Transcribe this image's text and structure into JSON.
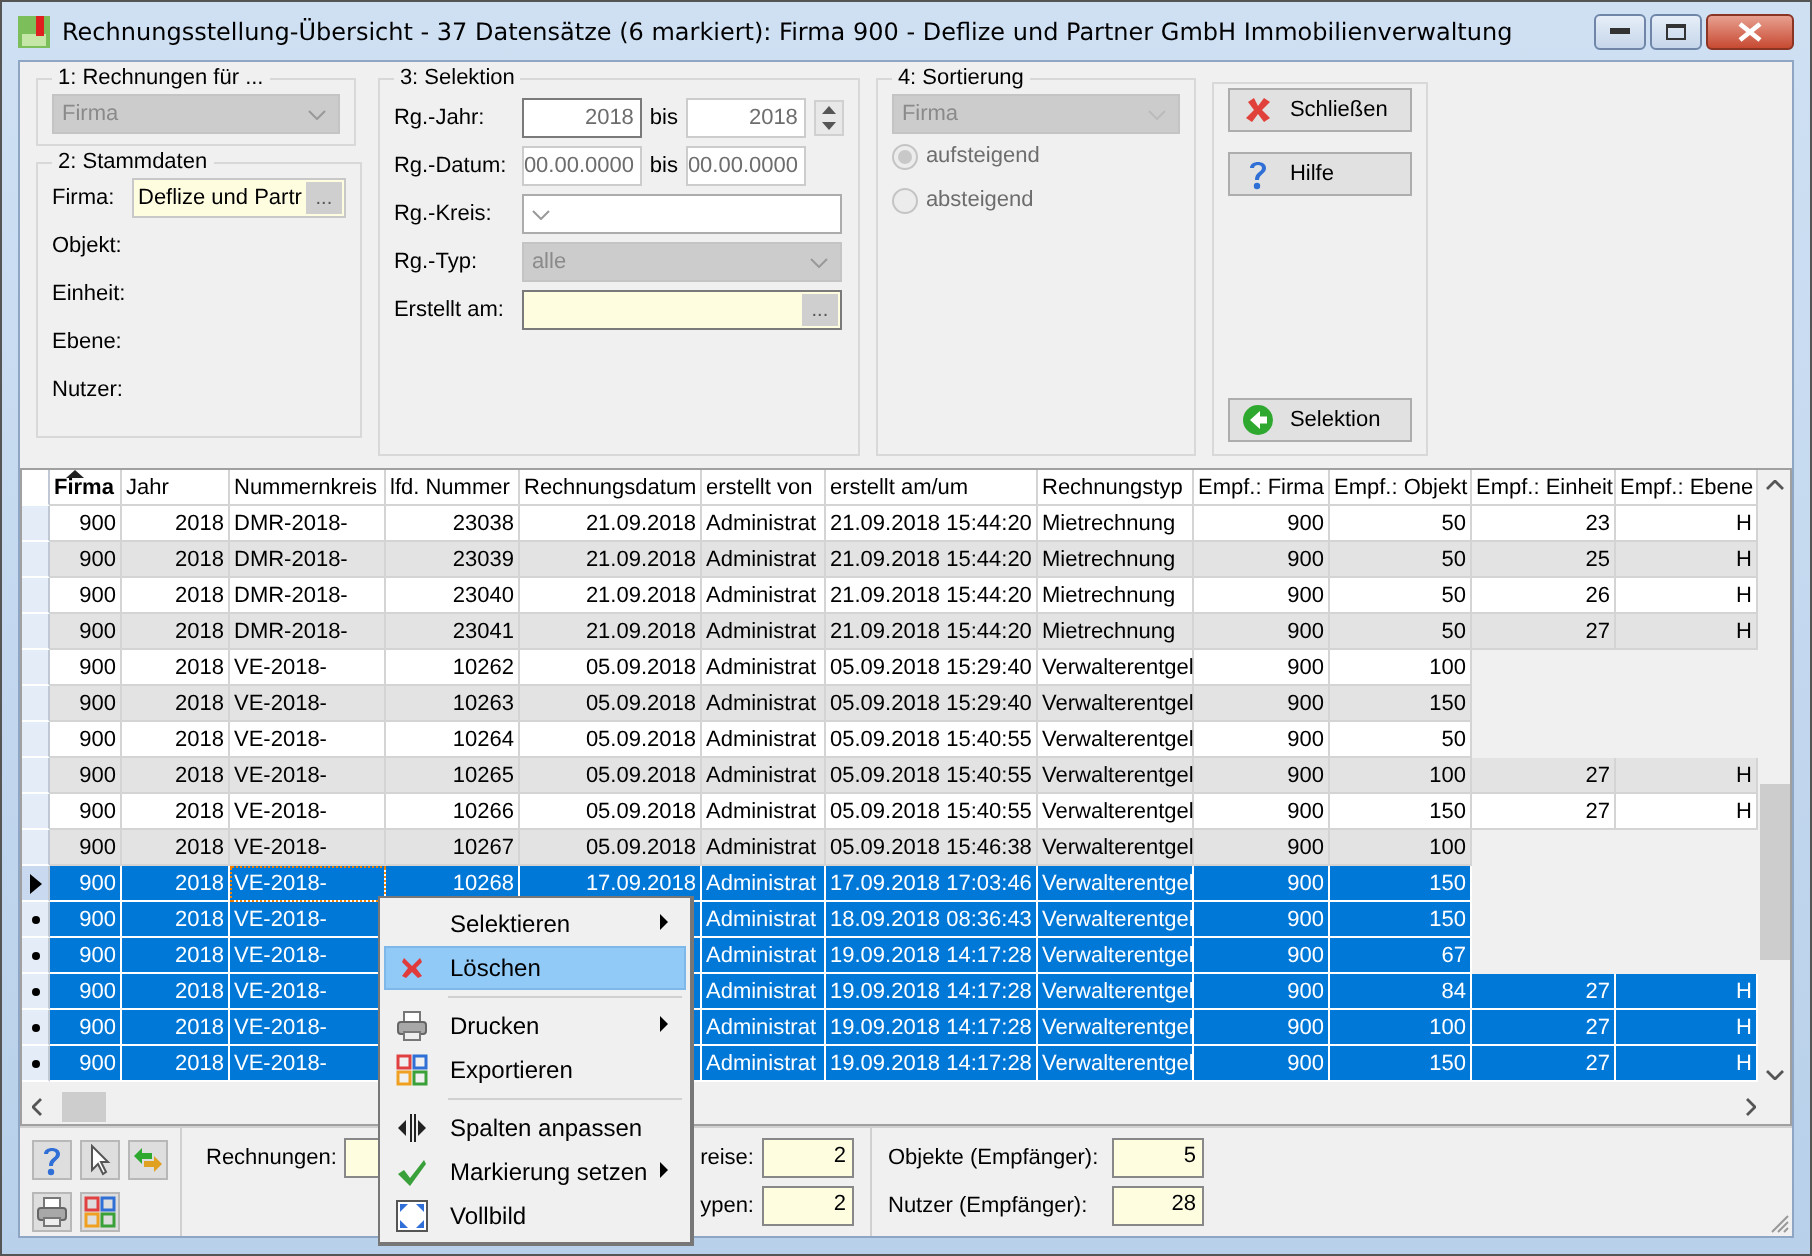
{
  "window": {
    "title": "Rechnungsstellung-Übersicht - 37 Datensätze (6 markiert):  Firma 900 - Deflize und Partner GmbH Immobilienverwaltung"
  },
  "group_1": {
    "title": "1: Rechnungen für ...",
    "combo": {
      "value": "Firma",
      "disabled": true
    }
  },
  "group_2": {
    "title": "2: Stammdaten",
    "fields": [
      {
        "label": "Firma:",
        "value": "Deflize und Partr",
        "button": "..."
      },
      {
        "label": "Objekt:"
      },
      {
        "label": "Einheit:"
      },
      {
        "label": "Ebene:"
      },
      {
        "label": "Nutzer:"
      }
    ]
  },
  "group_3": {
    "title": "3: Selektion",
    "rows": [
      {
        "kind": "range",
        "label": "Rg.-Jahr:",
        "from": "2018",
        "separator": "bis",
        "to": "2018",
        "spinner": true
      },
      {
        "kind": "range",
        "label": "Rg.-Datum:",
        "from": "00.00.0000",
        "separator": "bis",
        "to": "00.00.0000"
      },
      {
        "kind": "combo",
        "label": "Rg.-Kreis:",
        "disabled": false
      },
      {
        "kind": "combo",
        "label": "Rg.-Typ:",
        "value": "alle",
        "disabled": true
      },
      {
        "kind": "picker",
        "label": "Erstellt am:",
        "button": "..."
      }
    ]
  },
  "group_4": {
    "title": "4: Sortierung",
    "combo": {
      "value": "Firma",
      "disabled": true
    },
    "radios": [
      {
        "label": "aufsteigend",
        "selected": true,
        "disabled": true
      },
      {
        "label": "absteigend",
        "selected": false,
        "disabled": true
      }
    ]
  },
  "actions": [
    {
      "kind": "close",
      "label": "Schließen"
    },
    {
      "kind": "help",
      "label": "Hilfe"
    },
    {
      "kind": "back",
      "label": "Selektion"
    }
  ],
  "table": {
    "columns": [
      {
        "label": "Firma",
        "sorted": true
      },
      {
        "label": "Jahr",
        "sorted": false
      },
      {
        "label": "Nummernkreis",
        "sorted": false
      },
      {
        "label": "lfd. Nummer",
        "sorted": false
      },
      {
        "label": "Rechnungsdatum",
        "sorted": false
      },
      {
        "label": "erstellt von",
        "sorted": false
      },
      {
        "label": "erstellt am/um",
        "sorted": false
      },
      {
        "label": "Rechnungstyp",
        "sorted": false
      },
      {
        "label": "Empf.: Firma",
        "sorted": false
      },
      {
        "label": "Empf.: Objekt",
        "sorted": false
      },
      {
        "label": "Empf.: Einheit",
        "sorted": false
      },
      {
        "label": "Empf.: Ebene",
        "sorted": false
      }
    ],
    "rows": [
      {
        "selected": false,
        "current": false,
        "cells": [
          "900",
          "2018",
          "DMR-2018-",
          "23038",
          "21.09.2018",
          "Administrat",
          "21.09.2018 15:44:20",
          "Mietrechnung",
          "900",
          "50",
          "23",
          "H"
        ]
      },
      {
        "selected": false,
        "current": false,
        "cells": [
          "900",
          "2018",
          "DMR-2018-",
          "23039",
          "21.09.2018",
          "Administrat",
          "21.09.2018 15:44:20",
          "Mietrechnung",
          "900",
          "50",
          "25",
          "H"
        ]
      },
      {
        "selected": false,
        "current": false,
        "cells": [
          "900",
          "2018",
          "DMR-2018-",
          "23040",
          "21.09.2018",
          "Administrat",
          "21.09.2018 15:44:20",
          "Mietrechnung",
          "900",
          "50",
          "26",
          "H"
        ]
      },
      {
        "selected": false,
        "current": false,
        "cells": [
          "900",
          "2018",
          "DMR-2018-",
          "23041",
          "21.09.2018",
          "Administrat",
          "21.09.2018 15:44:20",
          "Mietrechnung",
          "900",
          "50",
          "27",
          "H"
        ]
      },
      {
        "selected": false,
        "current": false,
        "cells": [
          "900",
          "2018",
          "VE-2018-",
          "10262",
          "05.09.2018",
          "Administrat",
          "05.09.2018 15:29:40",
          "Verwalterentgel",
          "900",
          "100",
          null,
          null
        ]
      },
      {
        "selected": false,
        "current": false,
        "cells": [
          "900",
          "2018",
          "VE-2018-",
          "10263",
          "05.09.2018",
          "Administrat",
          "05.09.2018 15:29:40",
          "Verwalterentgel",
          "900",
          "150",
          null,
          null
        ]
      },
      {
        "selected": false,
        "current": false,
        "cells": [
          "900",
          "2018",
          "VE-2018-",
          "10264",
          "05.09.2018",
          "Administrat",
          "05.09.2018 15:40:55",
          "Verwalterentgel",
          "900",
          "50",
          null,
          null
        ]
      },
      {
        "selected": false,
        "current": false,
        "cells": [
          "900",
          "2018",
          "VE-2018-",
          "10265",
          "05.09.2018",
          "Administrat",
          "05.09.2018 15:40:55",
          "Verwalterentgel",
          "900",
          "100",
          "27",
          "H"
        ]
      },
      {
        "selected": false,
        "current": false,
        "cells": [
          "900",
          "2018",
          "VE-2018-",
          "10266",
          "05.09.2018",
          "Administrat",
          "05.09.2018 15:40:55",
          "Verwalterentgel",
          "900",
          "150",
          "27",
          "H"
        ]
      },
      {
        "selected": false,
        "current": false,
        "cells": [
          "900",
          "2018",
          "VE-2018-",
          "10267",
          "05.09.2018",
          "Administrat",
          "05.09.2018 15:46:38",
          "Verwalterentgel",
          "900",
          "100",
          null,
          null
        ]
      },
      {
        "selected": true,
        "current": true,
        "cells": [
          "900",
          "2018",
          "VE-2018-",
          "10268",
          "17.09.2018",
          "Administrat",
          "17.09.2018 17:03:46",
          "Verwalterentgel",
          "900",
          "150",
          null,
          null
        ]
      },
      {
        "selected": true,
        "current": false,
        "cells": [
          "900",
          "2018",
          "VE-2018-",
          null,
          null,
          "Administrat",
          "18.09.2018 08:36:43",
          "Verwalterentgel",
          "900",
          "150",
          null,
          null
        ]
      },
      {
        "selected": true,
        "current": false,
        "cells": [
          "900",
          "2018",
          "VE-2018-",
          null,
          null,
          "Administrat",
          "19.09.2018 14:17:28",
          "Verwalterentgel",
          "900",
          "67",
          null,
          null
        ]
      },
      {
        "selected": true,
        "current": false,
        "cells": [
          "900",
          "2018",
          "VE-2018-",
          null,
          null,
          "Administrat",
          "19.09.2018 14:17:28",
          "Verwalterentgel",
          "900",
          "84",
          "27",
          "H"
        ]
      },
      {
        "selected": true,
        "current": false,
        "cells": [
          "900",
          "2018",
          "VE-2018-",
          null,
          null,
          "Administrat",
          "19.09.2018 14:17:28",
          "Verwalterentgel",
          "900",
          "100",
          "27",
          "H"
        ]
      },
      {
        "selected": true,
        "current": false,
        "cells": [
          "900",
          "2018",
          "VE-2018-",
          null,
          null,
          "Administrat",
          "19.09.2018 14:17:28",
          "Verwalterentgel",
          "900",
          "150",
          "27",
          "H"
        ]
      }
    ]
  },
  "context_menu": {
    "items": [
      {
        "kind": "plain",
        "label": "Selektieren",
        "submenu": true,
        "selected": false
      },
      {
        "kind": "delete",
        "label": "Löschen",
        "submenu": false,
        "selected": true
      },
      {
        "kind": "separator"
      },
      {
        "kind": "printer",
        "label": "Drucken",
        "submenu": true,
        "selected": false
      },
      {
        "kind": "export",
        "label": "Exportieren",
        "submenu": false,
        "selected": false
      },
      {
        "kind": "separator"
      },
      {
        "kind": "columns",
        "label": "Spalten anpassen",
        "submenu": false,
        "selected": false
      },
      {
        "kind": "check",
        "label": "Markierung setzen",
        "submenu": true,
        "selected": false
      },
      {
        "kind": "fullscreen",
        "label": "Vollbild",
        "submenu": false,
        "selected": false
      }
    ]
  },
  "toolbar": [
    {
      "kind": "help"
    },
    {
      "kind": "pointer"
    },
    {
      "kind": "refresh"
    },
    {
      "kind": "printer"
    },
    {
      "kind": "export"
    }
  ],
  "summary": {
    "left": [
      {
        "label": "Rechnungen:"
      }
    ],
    "middle": [
      {
        "label": "reise:",
        "value": "2"
      },
      {
        "label": "ypen:",
        "value": "2"
      }
    ],
    "right": [
      {
        "label": "Objekte (Empfänger):",
        "value": "5"
      },
      {
        "label": "Nutzer (Empfänger):",
        "value": "28"
      }
    ]
  }
}
